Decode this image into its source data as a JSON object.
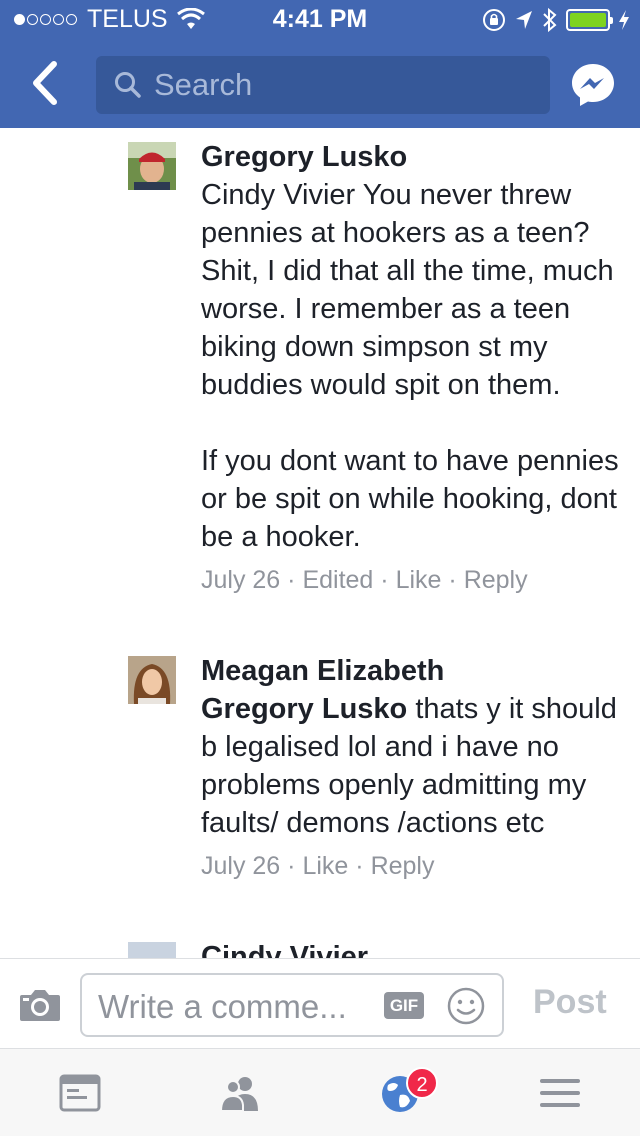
{
  "status_bar": {
    "carrier": "TELUS",
    "time": "4:41 PM"
  },
  "header": {
    "search_placeholder": "Search"
  },
  "comments": [
    {
      "author": "Gregory Lusko",
      "paragraphs": [
        "Cindy Vivier You never threw pennies at hookers as a teen? Shit, I did that all the time, much worse. I remember as a teen biking down simpson st my buddies would spit on them.",
        "If you dont want to have pennies or be spit on while hooking, dont be a hooker."
      ],
      "date": "July 26",
      "edited": "Edited",
      "like": "Like",
      "reply": "Reply"
    },
    {
      "author": "Meagan Elizabeth",
      "mention": "Gregory Lusko",
      "text": " thats y it should b legalised lol and i have no problems openly admitting my faults/ demons /actions etc",
      "date": "July 26",
      "like": "Like",
      "reply": "Reply"
    },
    {
      "author": "Cindy Vivier"
    }
  ],
  "composer": {
    "placeholder": "Write a comme...",
    "gif_label": "GIF",
    "post_label": "Post"
  },
  "tabbar": {
    "notifications_badge": "2"
  },
  "colors": {
    "header_blue": "#4267b2",
    "search_bg": "#365899",
    "badge_red": "#f02849",
    "meta_grey": "#90949c"
  },
  "icons": [
    "back-chevron-icon",
    "search-icon",
    "messenger-icon",
    "camera-icon",
    "smiley-icon",
    "news-feed-icon",
    "friends-icon",
    "globe-icon",
    "menu-icon"
  ]
}
